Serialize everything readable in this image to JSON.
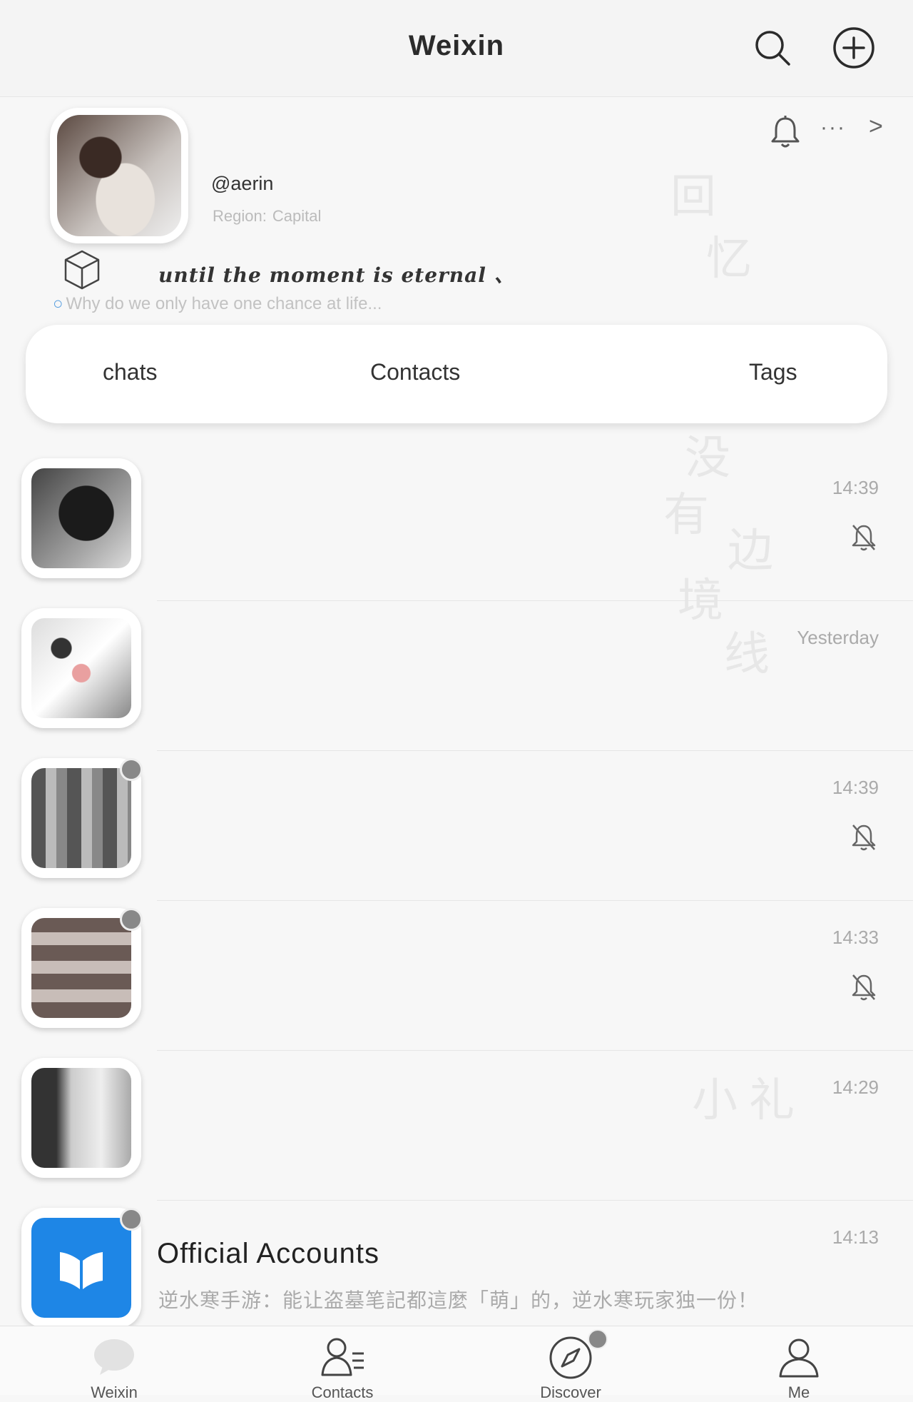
{
  "header": {
    "title": "Weixin"
  },
  "profile": {
    "username": "@aerin",
    "region_label": "Region:",
    "region_value": "Capital",
    "more": "···",
    "arrow": ">",
    "signature": "until the moment is eternal 、",
    "search_hint": "Why do we only have one chance at life..."
  },
  "tabs": {
    "chats": "chats",
    "contacts": "Contacts",
    "tags": "Tags"
  },
  "chats": [
    {
      "time": "14:39",
      "muted": true
    },
    {
      "time": "Yesterday",
      "muted": false
    },
    {
      "time": "14:39",
      "muted": true
    },
    {
      "time": "14:33",
      "muted": true
    },
    {
      "time": "14:29",
      "muted": false
    },
    {
      "title": "Official Accounts",
      "preview": "逆水寒手游：能让盗墓笔記都這麼「萌」的，逆水寒玩家独一份！",
      "time": "14:13"
    }
  ],
  "nav": {
    "weixin": "Weixin",
    "contacts": "Contacts",
    "discover": "Discover",
    "me": "Me"
  },
  "decorations": [
    "回",
    "忆",
    "没",
    "有",
    "边",
    "境",
    "线",
    "小",
    "礼"
  ],
  "icons": {
    "header": [
      "search-icon",
      "add-circle-icon"
    ],
    "profile": [
      "bell-icon",
      "cube-icon"
    ],
    "chat": [
      "mute-bell-icon"
    ],
    "nav": [
      "chat-bubble-icon",
      "contacts-icon",
      "compass-icon",
      "person-icon"
    ]
  },
  "colors": {
    "official_accounts_blue": "#1e86e6",
    "hint_search": "#5aa0e0"
  }
}
